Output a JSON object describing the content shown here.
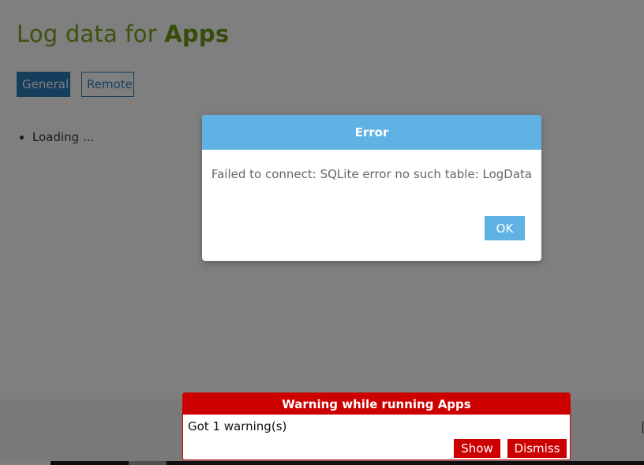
{
  "page": {
    "title_prefix": "Log data for",
    "title_app": "Apps",
    "tabs": [
      {
        "label": "General",
        "active": true
      },
      {
        "label": "Remote",
        "active": false
      }
    ],
    "loading_text": "Loading ..."
  },
  "dialog": {
    "title": "Error",
    "message": "Failed to connect: SQLite error no such table: LogData",
    "ok_label": "OK"
  },
  "warning": {
    "title": "Warning while running Apps",
    "message": "Got 1 warning(s)",
    "show_label": "Show",
    "dismiss_label": "Dismiss"
  },
  "colors": {
    "title_green": "#7aa51f",
    "tab_blue": "#2a7ab8",
    "dialog_header": "#5fb2e3",
    "warning_red": "#cc0000"
  }
}
